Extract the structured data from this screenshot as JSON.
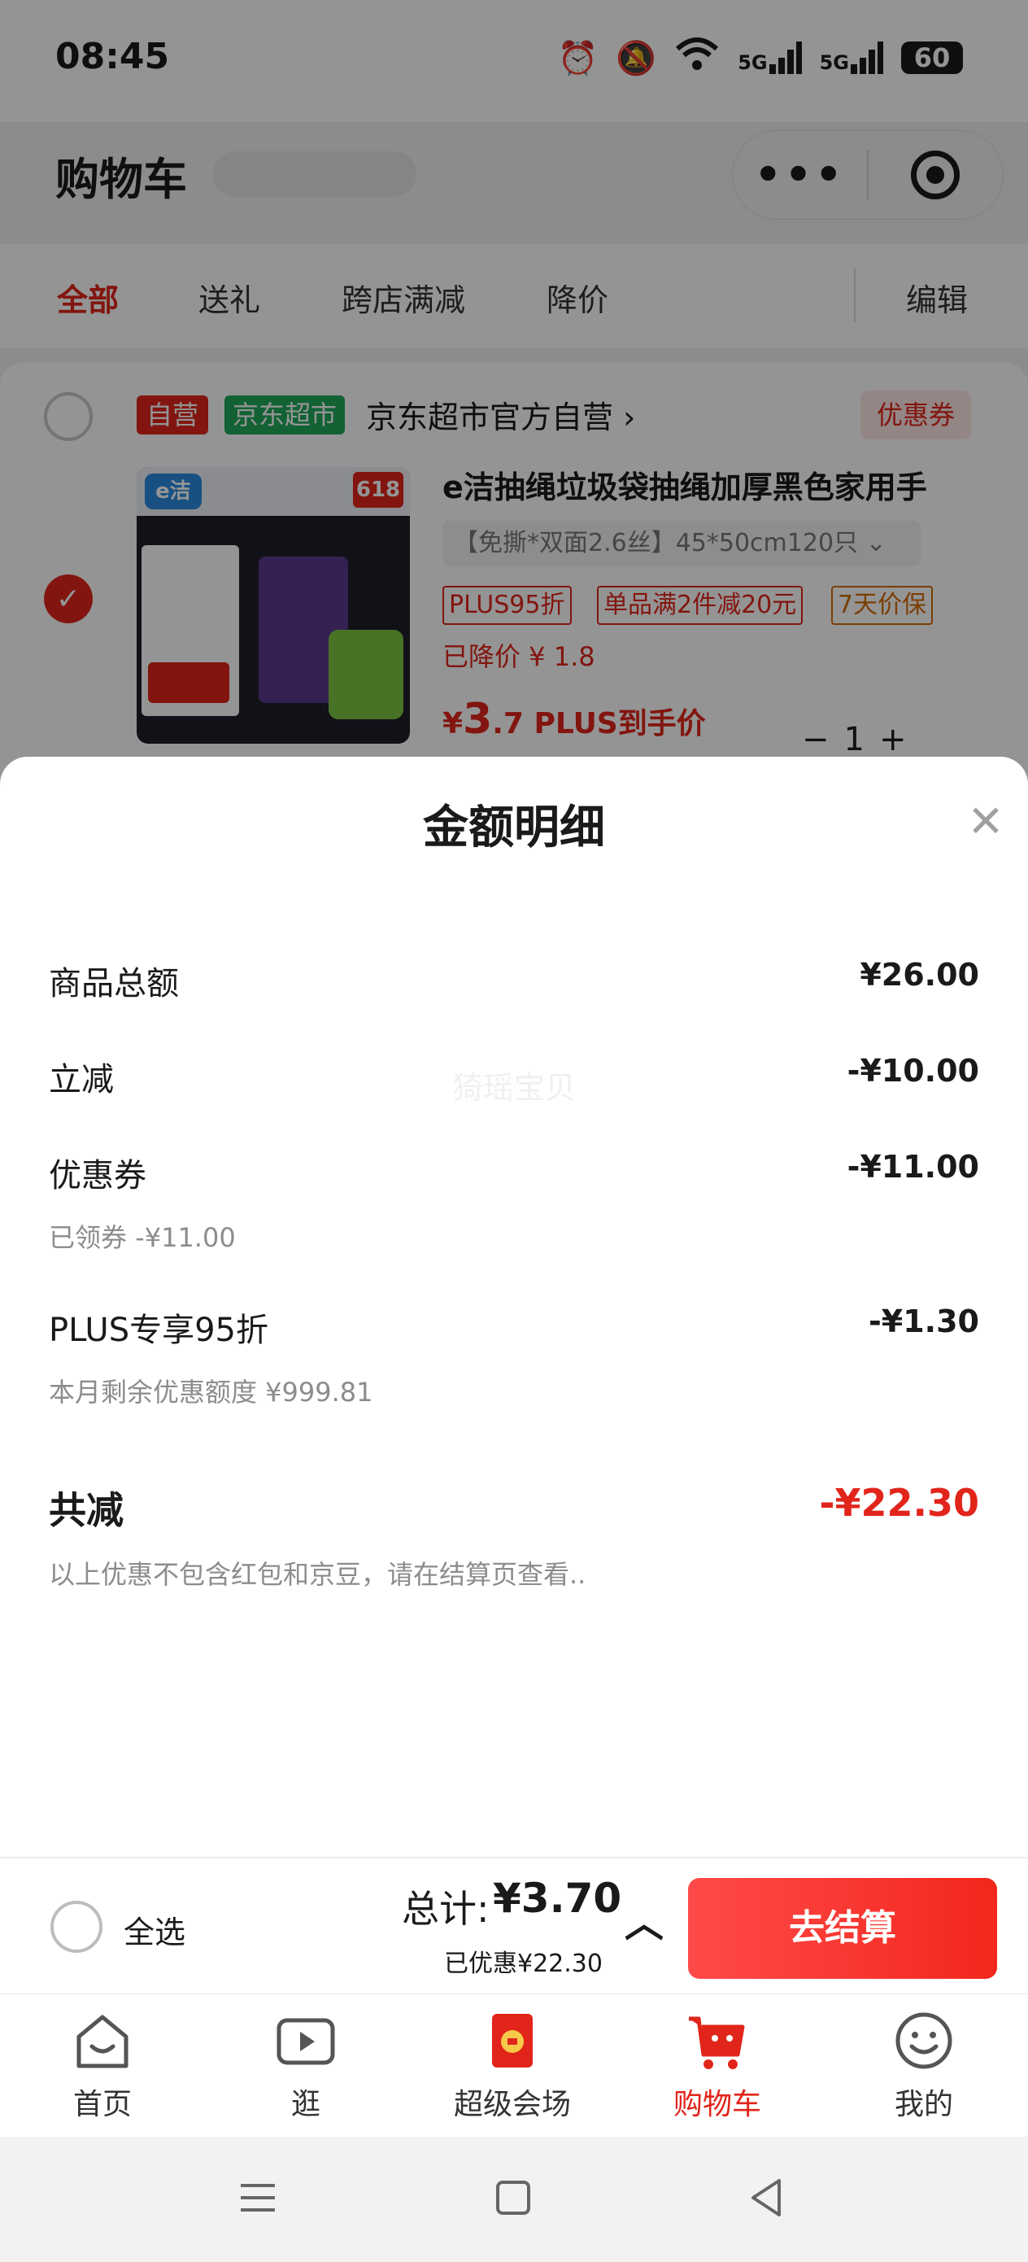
{
  "status_bar": {
    "time": "08:45",
    "battery": "60",
    "network_1": "5G",
    "network_2": "5G"
  },
  "header": {
    "title": "购物车"
  },
  "tabs": [
    {
      "label": "全部",
      "active": true
    },
    {
      "label": "送礼",
      "active": false
    },
    {
      "label": "跨店满减",
      "active": false
    },
    {
      "label": "降价",
      "active": false
    }
  ],
  "edit_label": "编辑",
  "shop": {
    "self_tag": "自营",
    "market_tag": "京东超市",
    "name": "京东超市官方自营 ›",
    "coupon_tag": "优惠券"
  },
  "product": {
    "title": "e洁抽绳垃圾袋抽绳加厚黑色家用手",
    "sku": "【免撕*双面2.6丝】45*50cm120只",
    "promos": [
      "PLUS95折",
      "单品满2件减20元",
      "7天价保"
    ],
    "price_drop": "已降价 ¥ 1.8",
    "price_symbol": "¥",
    "price_int": "3",
    "price_dec": ".7",
    "price_suffix": "PLUS到手价",
    "quantity": "1",
    "image": {
      "brand": "e洁",
      "badge": "618"
    }
  },
  "sheet": {
    "title": "金额明细",
    "watermark": "猗瑶宝贝",
    "rows": [
      {
        "label": "商品总额",
        "value": "¥26.00",
        "sub": ""
      },
      {
        "label": "立减",
        "value": "-¥10.00",
        "sub": ""
      },
      {
        "label": "优惠券",
        "value": "-¥11.00",
        "sub": "已领券 -¥11.00"
      },
      {
        "label": "PLUS专享95折",
        "value": "-¥1.30",
        "sub": "本月剩余优惠额度 ¥999.81"
      }
    ],
    "total_label": "共减",
    "total_value": "-¥22.30",
    "note": "以上优惠不包含红包和京豆，请在结算页查看.."
  },
  "checkout": {
    "select_all": "全选",
    "sum_label": "总计:",
    "sum_value": "¥3.70",
    "saved": "已优惠¥22.30",
    "button": "去结算"
  },
  "tabbar": [
    {
      "label": "首页",
      "icon": "home-icon",
      "active": false
    },
    {
      "label": "逛",
      "icon": "video-icon",
      "active": false
    },
    {
      "label": "超级会场",
      "icon": "red-envelope-icon",
      "active": false
    },
    {
      "label": "购物车",
      "icon": "cart-icon",
      "active": true
    },
    {
      "label": "我的",
      "icon": "smiley-icon",
      "active": false
    }
  ],
  "colors": {
    "brand_red": "#e1251b",
    "green_tag": "#1faa5a"
  }
}
